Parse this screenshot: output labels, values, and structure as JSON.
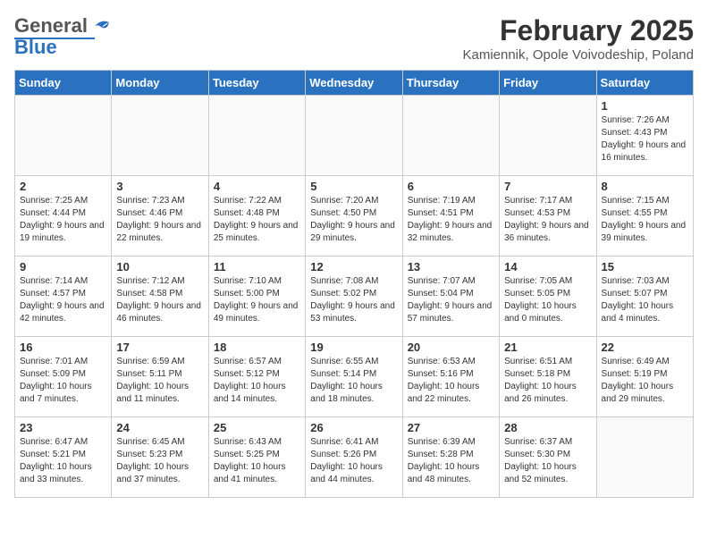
{
  "header": {
    "logo_general": "General",
    "logo_blue": "Blue",
    "title": "February 2025",
    "subtitle": "Kamiennik, Opole Voivodeship, Poland"
  },
  "weekdays": [
    "Sunday",
    "Monday",
    "Tuesday",
    "Wednesday",
    "Thursday",
    "Friday",
    "Saturday"
  ],
  "weeks": [
    [
      {
        "day": "",
        "info": ""
      },
      {
        "day": "",
        "info": ""
      },
      {
        "day": "",
        "info": ""
      },
      {
        "day": "",
        "info": ""
      },
      {
        "day": "",
        "info": ""
      },
      {
        "day": "",
        "info": ""
      },
      {
        "day": "1",
        "info": "Sunrise: 7:26 AM\nSunset: 4:43 PM\nDaylight: 9 hours and 16 minutes."
      }
    ],
    [
      {
        "day": "2",
        "info": "Sunrise: 7:25 AM\nSunset: 4:44 PM\nDaylight: 9 hours and 19 minutes."
      },
      {
        "day": "3",
        "info": "Sunrise: 7:23 AM\nSunset: 4:46 PM\nDaylight: 9 hours and 22 minutes."
      },
      {
        "day": "4",
        "info": "Sunrise: 7:22 AM\nSunset: 4:48 PM\nDaylight: 9 hours and 25 minutes."
      },
      {
        "day": "5",
        "info": "Sunrise: 7:20 AM\nSunset: 4:50 PM\nDaylight: 9 hours and 29 minutes."
      },
      {
        "day": "6",
        "info": "Sunrise: 7:19 AM\nSunset: 4:51 PM\nDaylight: 9 hours and 32 minutes."
      },
      {
        "day": "7",
        "info": "Sunrise: 7:17 AM\nSunset: 4:53 PM\nDaylight: 9 hours and 36 minutes."
      },
      {
        "day": "8",
        "info": "Sunrise: 7:15 AM\nSunset: 4:55 PM\nDaylight: 9 hours and 39 minutes."
      }
    ],
    [
      {
        "day": "9",
        "info": "Sunrise: 7:14 AM\nSunset: 4:57 PM\nDaylight: 9 hours and 42 minutes."
      },
      {
        "day": "10",
        "info": "Sunrise: 7:12 AM\nSunset: 4:58 PM\nDaylight: 9 hours and 46 minutes."
      },
      {
        "day": "11",
        "info": "Sunrise: 7:10 AM\nSunset: 5:00 PM\nDaylight: 9 hours and 49 minutes."
      },
      {
        "day": "12",
        "info": "Sunrise: 7:08 AM\nSunset: 5:02 PM\nDaylight: 9 hours and 53 minutes."
      },
      {
        "day": "13",
        "info": "Sunrise: 7:07 AM\nSunset: 5:04 PM\nDaylight: 9 hours and 57 minutes."
      },
      {
        "day": "14",
        "info": "Sunrise: 7:05 AM\nSunset: 5:05 PM\nDaylight: 10 hours and 0 minutes."
      },
      {
        "day": "15",
        "info": "Sunrise: 7:03 AM\nSunset: 5:07 PM\nDaylight: 10 hours and 4 minutes."
      }
    ],
    [
      {
        "day": "16",
        "info": "Sunrise: 7:01 AM\nSunset: 5:09 PM\nDaylight: 10 hours and 7 minutes."
      },
      {
        "day": "17",
        "info": "Sunrise: 6:59 AM\nSunset: 5:11 PM\nDaylight: 10 hours and 11 minutes."
      },
      {
        "day": "18",
        "info": "Sunrise: 6:57 AM\nSunset: 5:12 PM\nDaylight: 10 hours and 14 minutes."
      },
      {
        "day": "19",
        "info": "Sunrise: 6:55 AM\nSunset: 5:14 PM\nDaylight: 10 hours and 18 minutes."
      },
      {
        "day": "20",
        "info": "Sunrise: 6:53 AM\nSunset: 5:16 PM\nDaylight: 10 hours and 22 minutes."
      },
      {
        "day": "21",
        "info": "Sunrise: 6:51 AM\nSunset: 5:18 PM\nDaylight: 10 hours and 26 minutes."
      },
      {
        "day": "22",
        "info": "Sunrise: 6:49 AM\nSunset: 5:19 PM\nDaylight: 10 hours and 29 minutes."
      }
    ],
    [
      {
        "day": "23",
        "info": "Sunrise: 6:47 AM\nSunset: 5:21 PM\nDaylight: 10 hours and 33 minutes."
      },
      {
        "day": "24",
        "info": "Sunrise: 6:45 AM\nSunset: 5:23 PM\nDaylight: 10 hours and 37 minutes."
      },
      {
        "day": "25",
        "info": "Sunrise: 6:43 AM\nSunset: 5:25 PM\nDaylight: 10 hours and 41 minutes."
      },
      {
        "day": "26",
        "info": "Sunrise: 6:41 AM\nSunset: 5:26 PM\nDaylight: 10 hours and 44 minutes."
      },
      {
        "day": "27",
        "info": "Sunrise: 6:39 AM\nSunset: 5:28 PM\nDaylight: 10 hours and 48 minutes."
      },
      {
        "day": "28",
        "info": "Sunrise: 6:37 AM\nSunset: 5:30 PM\nDaylight: 10 hours and 52 minutes."
      },
      {
        "day": "",
        "info": ""
      }
    ]
  ]
}
